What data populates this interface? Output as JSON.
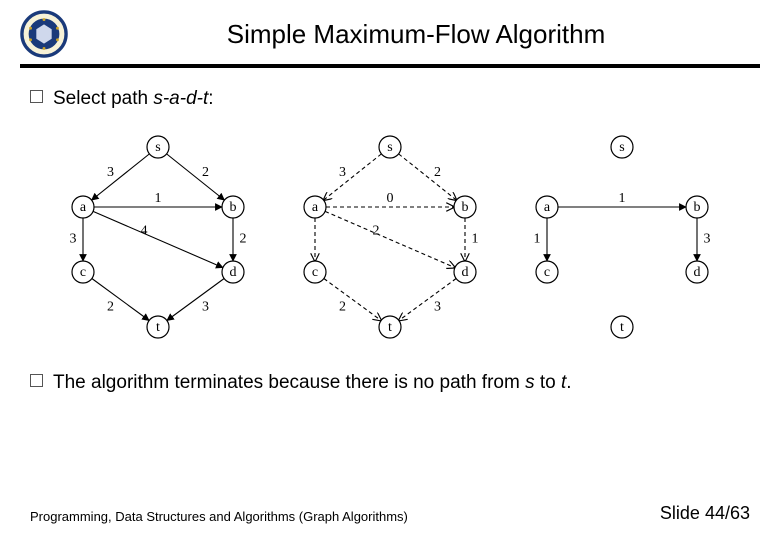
{
  "header": {
    "title": "Simple Maximum-Flow Algorithm"
  },
  "bullets": {
    "b1_prefix": "Select path ",
    "b1_path": "s-a-d-t",
    "b1_suffix": ":",
    "b2_prefix": "The algorithm terminates because there is no path from ",
    "b2_s": "s",
    "b2_mid": " to ",
    "b2_t": "t",
    "b2_suffix": "."
  },
  "footer": {
    "left": "Programming, Data Structures and Algorithms  (Graph Algorithms)",
    "right_label": "Slide ",
    "right_num": "44/63"
  },
  "graphs": [
    {
      "id": "G1",
      "nodes": {
        "s": "s",
        "a": "a",
        "b": "b",
        "c": "c",
        "d": "d",
        "t": "t"
      },
      "edges": [
        {
          "from": "s",
          "to": "a",
          "w": "3",
          "style": "solid"
        },
        {
          "from": "s",
          "to": "b",
          "w": "2",
          "style": "solid"
        },
        {
          "from": "a",
          "to": "b",
          "w": "1",
          "style": "solid"
        },
        {
          "from": "a",
          "to": "c",
          "w": "3",
          "style": "solid"
        },
        {
          "from": "a",
          "to": "d",
          "w": "4",
          "style": "solid"
        },
        {
          "from": "b",
          "to": "d",
          "w": "2",
          "style": "solid"
        },
        {
          "from": "c",
          "to": "t",
          "w": "2",
          "style": "solid"
        },
        {
          "from": "d",
          "to": "t",
          "w": "3",
          "style": "solid"
        }
      ]
    },
    {
      "id": "G2",
      "nodes": {
        "s": "s",
        "a": "a",
        "b": "b",
        "c": "c",
        "d": "d",
        "t": "t"
      },
      "edges": [
        {
          "from": "s",
          "to": "a",
          "w": "3",
          "style": "dashed"
        },
        {
          "from": "s",
          "to": "b",
          "w": "2",
          "style": "dashed"
        },
        {
          "from": "a",
          "to": "b",
          "w": "0",
          "style": "dashed"
        },
        {
          "from": "a",
          "to": "c",
          "w": "",
          "style": "dashed"
        },
        {
          "from": "a",
          "to": "d",
          "w": "2",
          "style": "dashed"
        },
        {
          "from": "b",
          "to": "d",
          "w": "1",
          "style": "dashed"
        },
        {
          "from": "c",
          "to": "t",
          "w": "2",
          "style": "dashed"
        },
        {
          "from": "d",
          "to": "t",
          "w": "3",
          "style": "dashed"
        }
      ]
    },
    {
      "id": "G3",
      "nodes": {
        "s": "s",
        "a": "a",
        "b": "b",
        "c": "c",
        "d": "d",
        "t": "t"
      },
      "edges": [
        {
          "from": "a",
          "to": "b",
          "w": "1",
          "style": "solid"
        },
        {
          "from": "a",
          "to": "c",
          "w": "1",
          "style": "solid"
        },
        {
          "from": "b",
          "to": "d",
          "w": "3",
          "style": "solid"
        }
      ]
    }
  ]
}
